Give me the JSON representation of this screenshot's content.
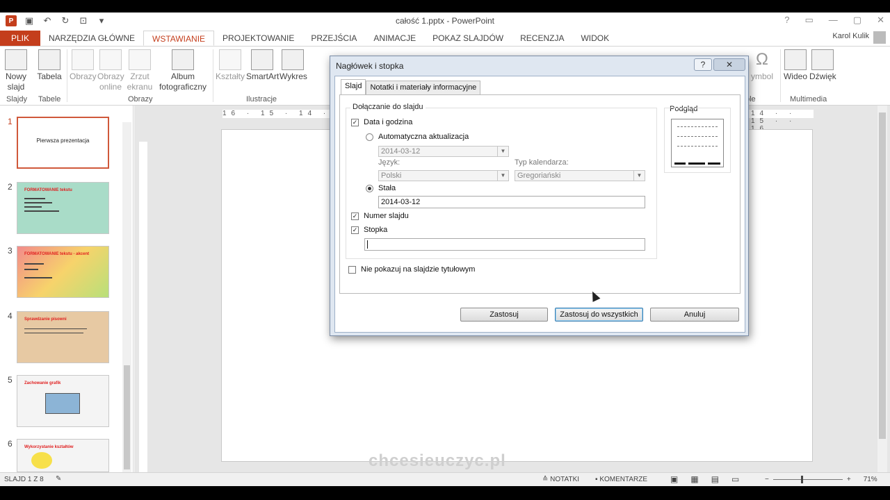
{
  "window": {
    "title": "całość 1.pptx - PowerPoint",
    "user": "Karol Kulik",
    "controls": [
      "?",
      "▭",
      "—",
      "▢",
      "✕"
    ]
  },
  "qat": {
    "app_icon": "P",
    "save_icon": "save-icon",
    "undo_icon": "undo-icon",
    "redo_icon": "redo-icon",
    "present_icon": "present-icon",
    "customize_icon": "customize-icon"
  },
  "tabs": [
    "PLIK",
    "NARZĘDZIA GŁÓWNE",
    "WSTAWIANIE",
    "PROJEKTOWANIE",
    "PRZEJŚCIA",
    "ANIMACJE",
    "POKAZ SLAJDÓW",
    "RECENZJA",
    "WIDOK"
  ],
  "active_tab": "WSTAWIANIE",
  "ribbon": {
    "new_slide": "Nowy slajd",
    "table": "Tabela",
    "pictures": "Obrazy",
    "online_pictures": "Obrazy online",
    "screenshot": "Zrzut ekranu",
    "album": "Album fotograficzny",
    "shapes": "Kształty",
    "smartart": "SmartArt",
    "chart": "Wykres",
    "symbol": "ymbol",
    "video": "Wideo",
    "audio": "Dźwięk",
    "groups": {
      "slides": "Slajdy",
      "tables": "Tabele",
      "images": "Obrazy",
      "illustrations": "Ilustracje",
      "symbols": "ole",
      "multimedia": "Multimedia"
    }
  },
  "ruler": {
    "left": "16 · 15 · 14 · 13 · 12 · 11",
    "right": "14 · · 15 · · 16"
  },
  "slides": [
    {
      "num": "1",
      "title": "Pierwsza prezentacja"
    },
    {
      "num": "2",
      "title": "FORMATOWANIE tekstu"
    },
    {
      "num": "3",
      "title": "FORMATOWANIE tekstu - akcent"
    },
    {
      "num": "4",
      "title": "Sprawdzanie pisowni"
    },
    {
      "num": "5",
      "title": "Zachowanie grafik"
    },
    {
      "num": "6",
      "title": "Wykorzystanie kształtów"
    }
  ],
  "watermark": "chcesieuczyc.pl",
  "status": {
    "slide_info": "SLAJD 1 Z 8",
    "notes": "NOTATKI",
    "comments": "KOMENTARZE",
    "zoom": "71%",
    "zoom_level": 0.71
  },
  "dialog": {
    "title": "Nagłówek i stopka",
    "help": "?",
    "close": "✕",
    "tabs": [
      "Slajd",
      "Notatki i materiały informacyjne"
    ],
    "section": "Dołączanie do slajdu",
    "date_time": "Data i godzina",
    "auto_update": "Automatyczna aktualizacja",
    "auto_date": "2014-03-12",
    "language_label": "Język:",
    "language": "Polski",
    "calendar_label": "Typ kalendarza:",
    "calendar": "Gregoriański",
    "fixed": "Stała",
    "fixed_value": "2014-03-12",
    "slide_number": "Numer slajdu",
    "footer": "Stopka",
    "footer_value": "",
    "dont_show_title": "Nie pokazuj na slajdzie tytułowym",
    "preview": "Podgląd",
    "apply": "Zastosuj",
    "apply_all": "Zastosuj do wszystkich",
    "cancel": "Anuluj",
    "checked": {
      "date_time": true,
      "slide_number": true,
      "footer": true,
      "dont_show_title": false
    },
    "selected_radio": "fixed"
  }
}
